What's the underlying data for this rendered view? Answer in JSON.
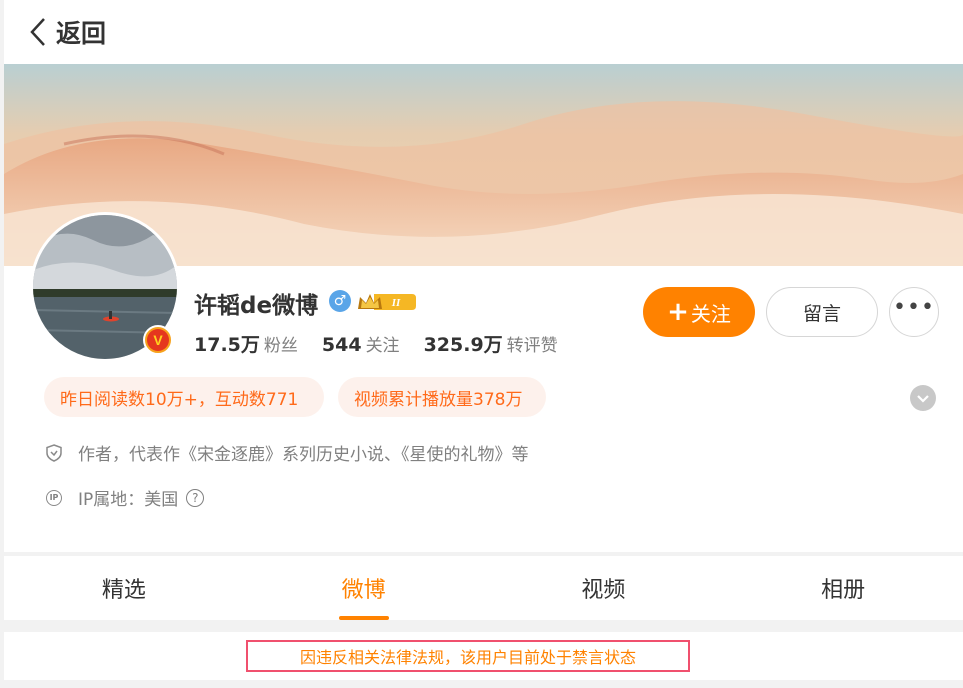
{
  "header": {
    "back_label": "返回"
  },
  "profile": {
    "name": "许韬de微博",
    "vip_level": "II",
    "verified_badge": "V",
    "gender_symbol": "♂",
    "stats": [
      {
        "value": "17.5万",
        "label": "粉丝"
      },
      {
        "value": "544",
        "label": "关注"
      },
      {
        "value": "325.9万",
        "label": "转评赞"
      }
    ],
    "tags": [
      "昨日阅读数10万+，互动数771",
      "视频累计播放量378万"
    ],
    "bio": "作者，代表作《宋金逐鹿》系列历史小说、《星使的礼物》等",
    "ip_location": "IP属地：美国",
    "ip_icon_text": "IP"
  },
  "actions": {
    "follow_plus": "+",
    "follow_label": "关注",
    "message_label": "留言",
    "more_label": "•••"
  },
  "tabs": [
    {
      "label": "精选"
    },
    {
      "label": "微博"
    },
    {
      "label": "视频"
    },
    {
      "label": "相册"
    }
  ],
  "active_tab": "微博",
  "notice": "因违反相关法律法规，该用户目前处于禁言状态",
  "colors": {
    "accent": "#ff8200",
    "notice_border": "#f0506e",
    "tag_bg": "#fdf1ec"
  }
}
